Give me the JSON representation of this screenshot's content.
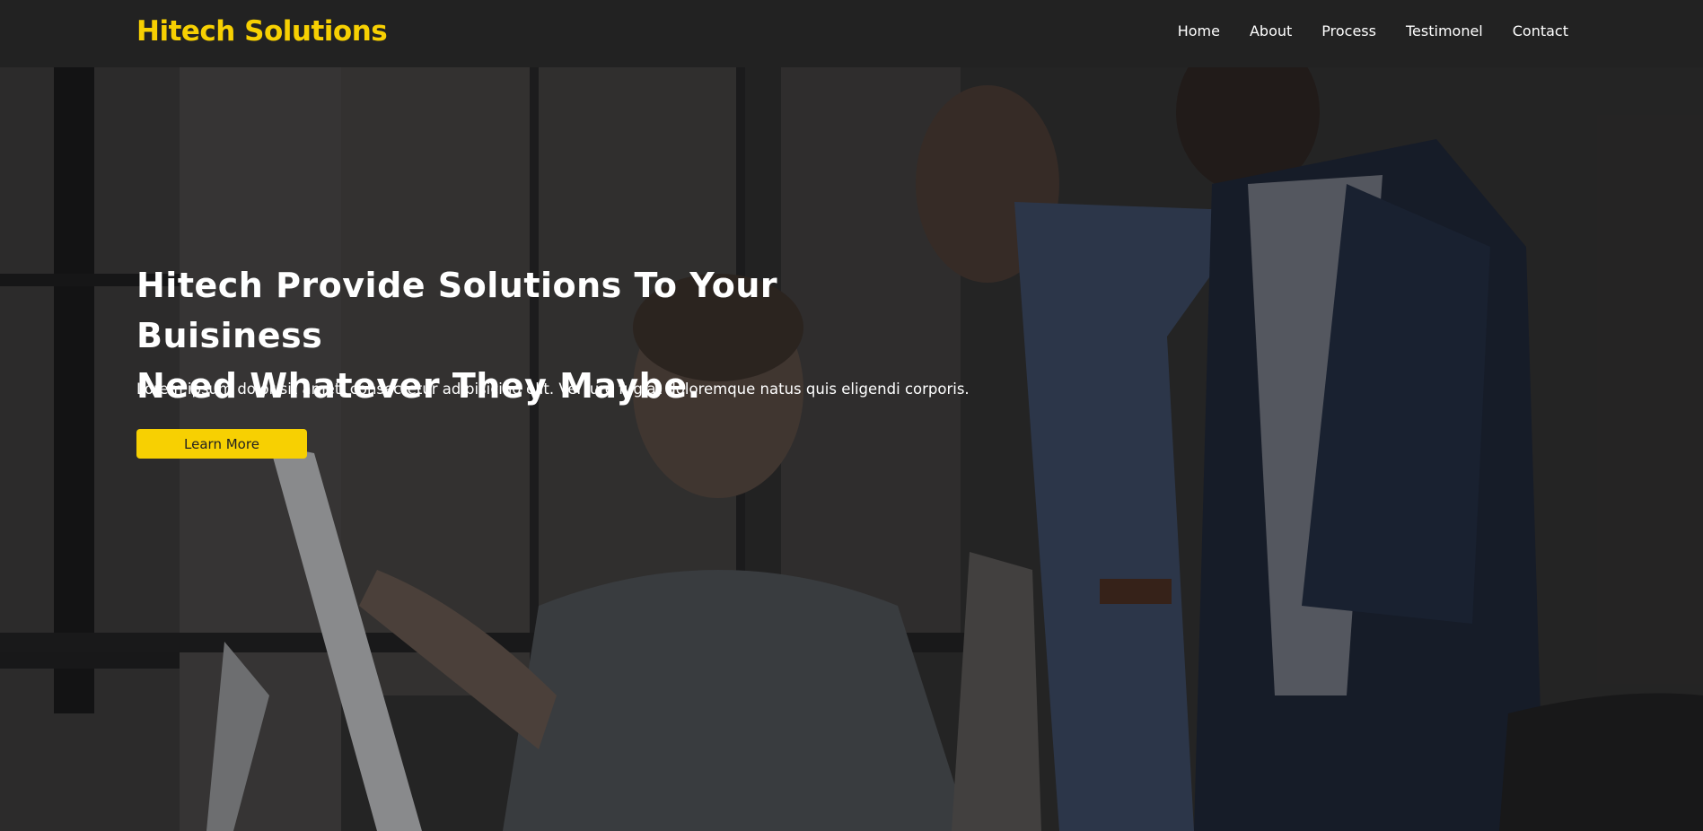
{
  "header": {
    "brand": "Hitech Solutions",
    "nav": [
      "Home",
      "About",
      "Process",
      "Testimonel",
      "Contact"
    ]
  },
  "hero": {
    "headline_line1": "Hitech Provide Solutions To Your Buisiness",
    "headline_line2": "Need Whatever They Maybe.",
    "subtext": "Lorem ipsum dolor sit amet, consectetur adipisicing elit. Vel iure fugiat doloremque natus quis eligendi corporis.",
    "cta_label": "Learn More"
  },
  "colors": {
    "accent": "#f7d002",
    "header_bg": "#222222",
    "text": "#ffffff"
  }
}
